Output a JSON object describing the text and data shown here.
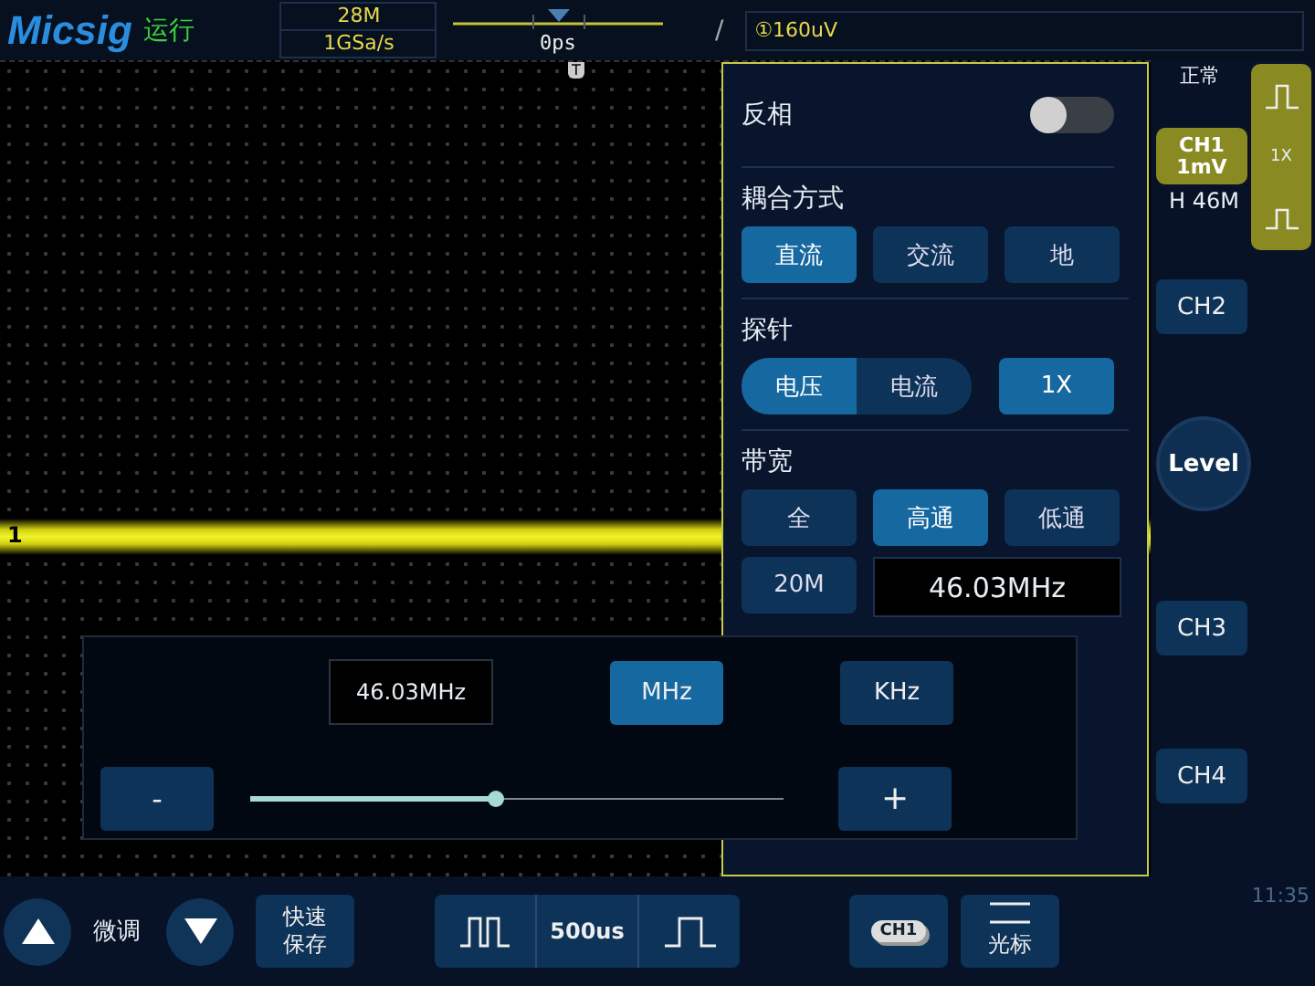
{
  "header": {
    "brand": "Micsig",
    "run_state": "运行",
    "memory_depth": "28M",
    "sample_rate": "1GSa/s",
    "time_offset": "0ps",
    "trigger_marker": "T",
    "trigger_slope": "/",
    "trigger_level": "①160uV"
  },
  "waveform": {
    "channel_label": "1"
  },
  "channel_panel": {
    "invert": {
      "label": "反相",
      "on": false
    },
    "coupling": {
      "label": "耦合方式",
      "options": [
        {
          "label": "直流",
          "selected": true
        },
        {
          "label": "交流",
          "selected": false
        },
        {
          "label": "地",
          "selected": false
        }
      ]
    },
    "probe": {
      "label": "探针",
      "options": [
        {
          "label": "电压",
          "selected": true
        },
        {
          "label": "电流",
          "selected": false
        }
      ],
      "ratio": "1X"
    },
    "bandwidth": {
      "label": "带宽",
      "options": [
        {
          "label": "全",
          "selected": false
        },
        {
          "label": "高通",
          "selected": true
        },
        {
          "label": "低通",
          "selected": false
        }
      ],
      "limit_button": "20M",
      "value": "46.03MHz"
    }
  },
  "bandwidth_popup": {
    "value": "46.03MHz",
    "units": [
      {
        "label": "MHz",
        "selected": true
      },
      {
        "label": "KHz",
        "selected": false
      }
    ],
    "minus": "-",
    "plus": "+",
    "slider": {
      "level": 0.46
    }
  },
  "right_column": {
    "acquire_mode": "正常",
    "ch1": {
      "name": "CH1",
      "scale": "1mV",
      "bandwidth": "H 46M"
    },
    "probe_ratio": "1X",
    "channels": [
      "CH2",
      "CH3",
      "CH4"
    ],
    "level_button": "Level"
  },
  "bottom_bar": {
    "fine_label": "微调",
    "quick_save": [
      "快速",
      "保存"
    ],
    "timebase": "500us",
    "ch1_badge": "CH1",
    "cursor_label": "光标",
    "clock": "11:35"
  }
}
